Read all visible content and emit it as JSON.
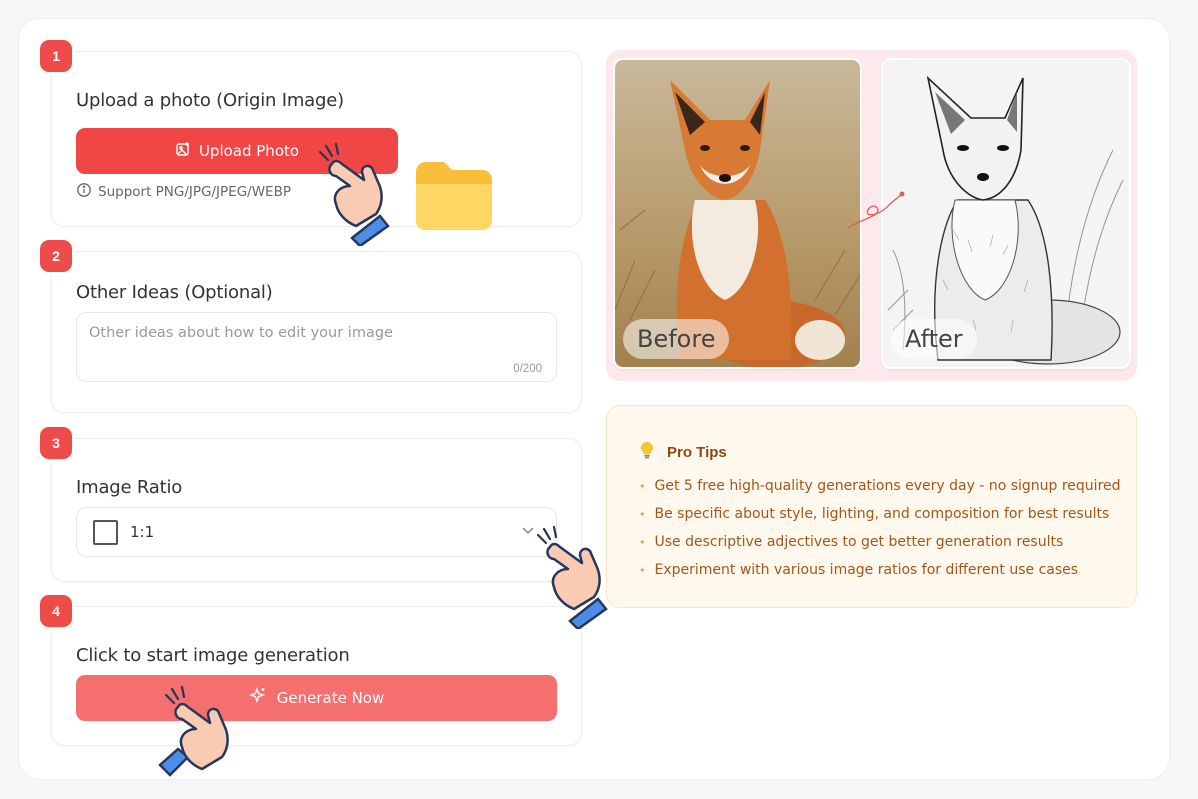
{
  "steps": [
    {
      "num": "1",
      "title": "Upload a photo (Origin Image)"
    },
    {
      "num": "2",
      "title": "Other Ideas (Optional)"
    },
    {
      "num": "3",
      "title": "Image Ratio"
    },
    {
      "num": "4",
      "title": "Click to start image generation"
    }
  ],
  "upload": {
    "button_label": "Upload Photo",
    "support_text": "Support PNG/JPG/JPEG/WEBP"
  },
  "ideas": {
    "placeholder": "Other ideas about how to edit your image",
    "counter": "0/200"
  },
  "ratio": {
    "selected": "1:1"
  },
  "generate": {
    "button_label": "Generate Now"
  },
  "compare": {
    "before_label": "Before",
    "after_label": "After"
  },
  "tips": {
    "title": "Pro Tips",
    "items": [
      "Get 5 free high-quality generations every day - no signup required",
      "Be specific about style, lighting, and composition for best results",
      "Use descriptive adjectives to get better generation results",
      "Experiment with various image ratios for different use cases"
    ]
  },
  "colors": {
    "accent": "#f04646",
    "generate": "#f56f6f",
    "tips_bg": "#fff8ec",
    "compare_bg": "#fde9ec"
  },
  "icons": [
    "image-add-icon",
    "info-icon",
    "chevron-down-icon",
    "sparkle-icon",
    "lightbulb-icon",
    "pointing-hand-icon",
    "folder-icon"
  ]
}
